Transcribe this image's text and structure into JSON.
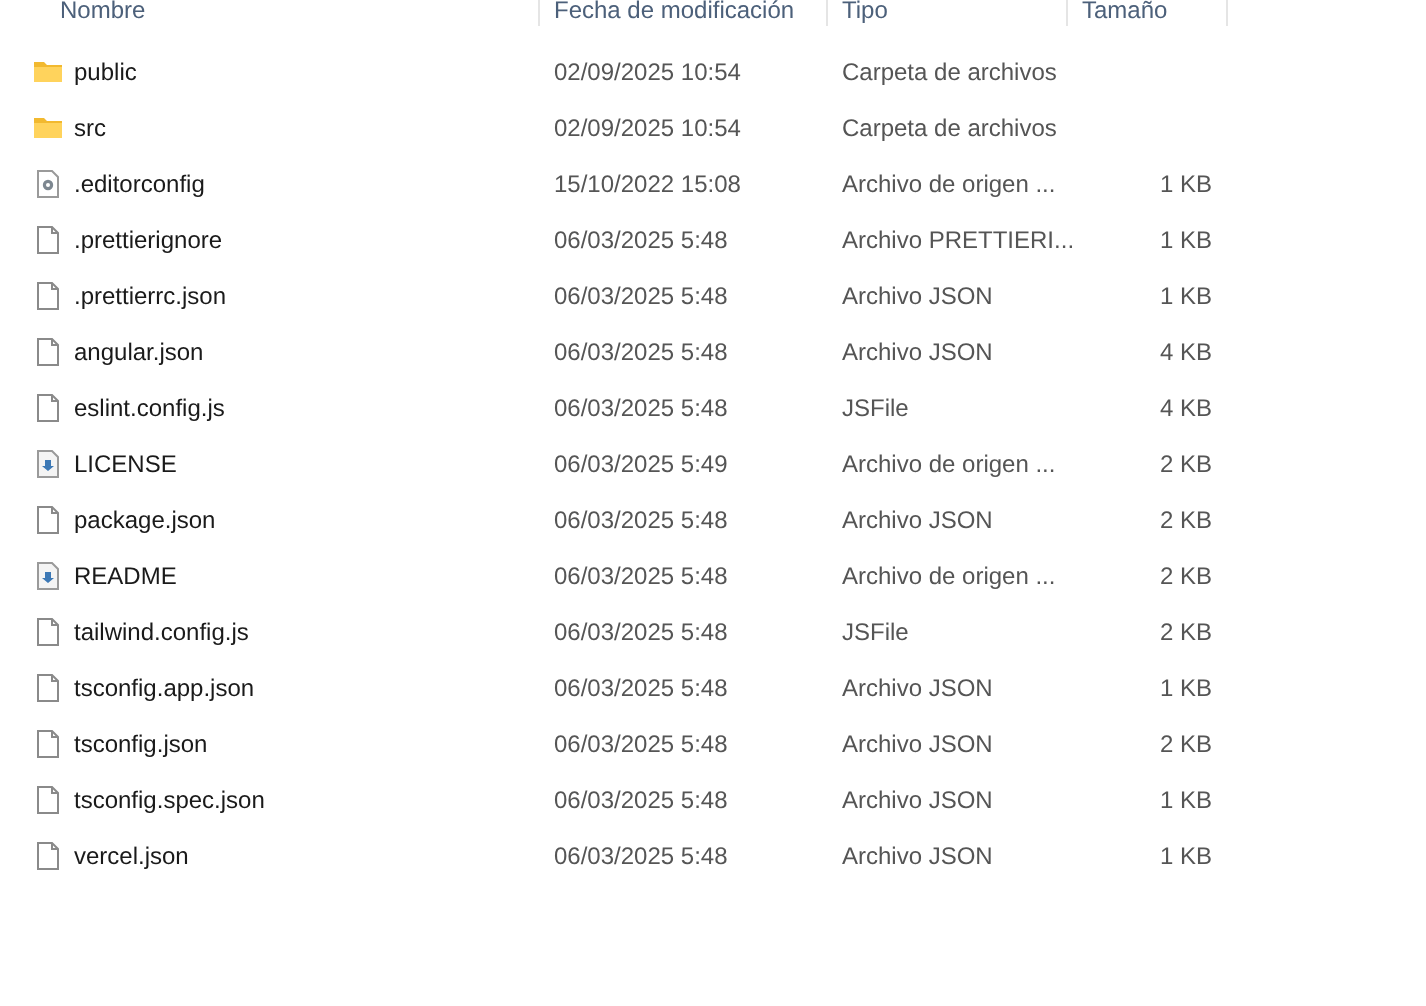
{
  "columns": [
    "Nombre",
    "Fecha de modificación",
    "Tipo",
    "Tamaño"
  ],
  "rows": [
    {
      "kind": "folder",
      "name": "public",
      "date": "02/09/2025 10:54",
      "type": "Carpeta de archivos"
    },
    {
      "kind": "folder",
      "name": "src",
      "date": "02/09/2025 10:54",
      "type": "Carpeta de archivos"
    },
    {
      "kind": "settings",
      "name": ".editorconfig",
      "date": "15/10/2022 15:08",
      "type": "Archivo de origen ...",
      "size": "1 KB"
    },
    {
      "kind": "file",
      "name": ".prettierignore",
      "date": "06/03/2025 5:48",
      "type": "Archivo PRETTIERI...",
      "size": "1 KB"
    },
    {
      "kind": "file",
      "name": ".prettierrc.json",
      "date": "06/03/2025 5:48",
      "type": "Archivo JSON",
      "size": "1 KB"
    },
    {
      "kind": "file",
      "name": "angular.json",
      "date": "06/03/2025 5:48",
      "type": "Archivo JSON",
      "size": "4 KB"
    },
    {
      "kind": "file",
      "name": "eslint.config.js",
      "date": "06/03/2025 5:48",
      "type": "JSFile",
      "size": "4 KB"
    },
    {
      "kind": "source",
      "name": "LICENSE",
      "date": "06/03/2025 5:49",
      "type": "Archivo de origen ...",
      "size": "2 KB"
    },
    {
      "kind": "file",
      "name": "package.json",
      "date": "06/03/2025 5:48",
      "type": "Archivo JSON",
      "size": "2 KB"
    },
    {
      "kind": "source",
      "name": "README",
      "date": "06/03/2025 5:48",
      "type": "Archivo de origen ...",
      "size": "2 KB"
    },
    {
      "kind": "file",
      "name": "tailwind.config.js",
      "date": "06/03/2025 5:48",
      "type": "JSFile",
      "size": "2 KB"
    },
    {
      "kind": "file",
      "name": "tsconfig.app.json",
      "date": "06/03/2025 5:48",
      "type": "Archivo JSON",
      "size": "1 KB"
    },
    {
      "kind": "file",
      "name": "tsconfig.json",
      "date": "06/03/2025 5:48",
      "type": "Archivo JSON",
      "size": "2 KB"
    },
    {
      "kind": "file",
      "name": "tsconfig.spec.json",
      "date": "06/03/2025 5:48",
      "type": "Archivo JSON",
      "size": "1 KB"
    },
    {
      "kind": "file",
      "name": "vercel.json",
      "date": "06/03/2025 5:48",
      "type": "Archivo JSON",
      "size": "1 KB"
    }
  ]
}
